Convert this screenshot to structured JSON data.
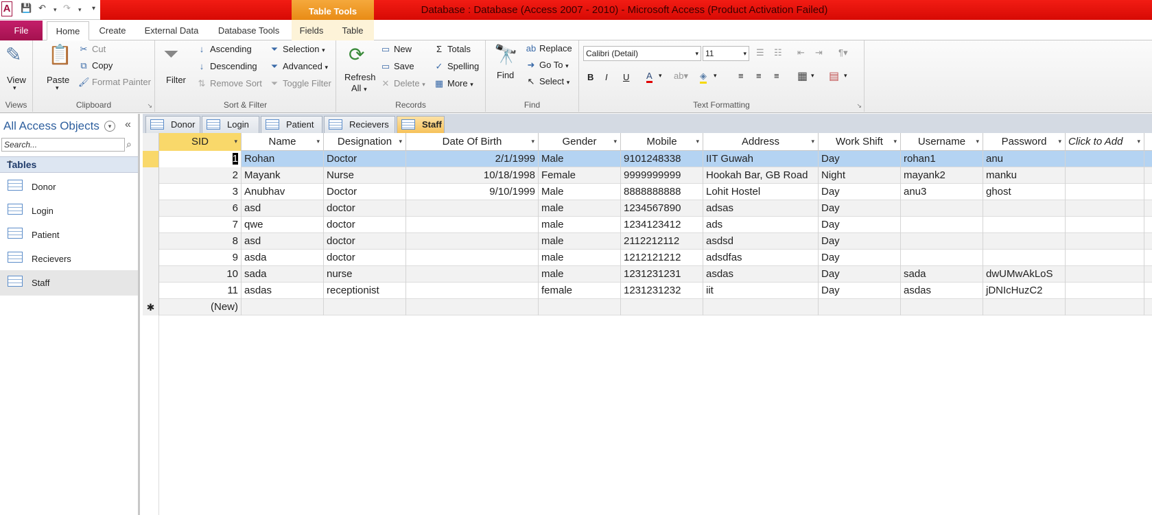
{
  "window": {
    "title": "Database : Database (Access 2007 - 2010) -  Microsoft Access (Product Activation Failed)",
    "context_tab": "Table Tools"
  },
  "ribbon_tabs": {
    "file": "File",
    "home": "Home",
    "create": "Create",
    "external_data": "External Data",
    "database_tools": "Database Tools",
    "fields": "Fields",
    "table": "Table"
  },
  "ribbon": {
    "views": {
      "label": "Views",
      "view": "View"
    },
    "clipboard": {
      "label": "Clipboard",
      "paste": "Paste",
      "cut": "Cut",
      "copy": "Copy",
      "format_painter": "Format Painter"
    },
    "sort_filter": {
      "label": "Sort & Filter",
      "filter": "Filter",
      "ascending": "Ascending",
      "descending": "Descending",
      "remove_sort": "Remove Sort",
      "selection": "Selection",
      "advanced": "Advanced",
      "toggle_filter": "Toggle Filter"
    },
    "records": {
      "label": "Records",
      "refresh": "Refresh",
      "refresh_all": "All",
      "new": "New",
      "save": "Save",
      "delete": "Delete",
      "totals": "Totals",
      "spelling": "Spelling",
      "more": "More"
    },
    "find": {
      "label": "Find",
      "find": "Find",
      "replace": "Replace",
      "goto": "Go To",
      "select": "Select"
    },
    "text_formatting": {
      "label": "Text Formatting",
      "font": "Calibri (Detail)",
      "size": "11"
    }
  },
  "nav": {
    "title": "All Access Objects",
    "search_placeholder": "Search...",
    "section": "Tables",
    "items": [
      {
        "label": "Donor"
      },
      {
        "label": "Login"
      },
      {
        "label": "Patient"
      },
      {
        "label": "Recievers"
      },
      {
        "label": "Staff"
      }
    ]
  },
  "doc_tabs": [
    "Donor",
    "Login",
    "Patient",
    "Recievers",
    "Staff"
  ],
  "grid": {
    "columns": [
      "SID",
      "Name",
      "Designation",
      "Date Of Birth",
      "Gender",
      "Mobile",
      "Address",
      "Work Shift",
      "Username",
      "Password",
      "Click to Add"
    ],
    "rows": [
      [
        "1",
        "Rohan",
        "Doctor",
        "2/1/1999",
        "Male",
        "9101248338",
        "IIT Guwah",
        "Day",
        "rohan1",
        "anu"
      ],
      [
        "2",
        "Mayank",
        "Nurse",
        "10/18/1998",
        "Female",
        "9999999999",
        "Hookah Bar, GB Road",
        "Night",
        "mayank2",
        "manku"
      ],
      [
        "3",
        "Anubhav",
        "Doctor",
        "9/10/1999",
        "Male",
        "8888888888",
        "Lohit Hostel",
        "Day",
        "anu3",
        "ghost"
      ],
      [
        "6",
        "asd",
        "doctor",
        "",
        "male",
        "1234567890",
        "adsas",
        "Day",
        "",
        ""
      ],
      [
        "7",
        "qwe",
        "doctor",
        "",
        "male",
        "1234123412",
        "ads",
        "Day",
        "",
        ""
      ],
      [
        "8",
        "asd",
        "doctor",
        "",
        "male",
        "2112212112",
        "asdsd",
        "Day",
        "",
        ""
      ],
      [
        "9",
        "asda",
        "doctor",
        "",
        "male",
        "1212121212",
        "adsdfas",
        "Day",
        "",
        ""
      ],
      [
        "10",
        "sada",
        "nurse",
        "",
        "male",
        "1231231231",
        "asdas",
        "Day",
        "sada",
        "dwUMwAkLoS"
      ],
      [
        "11",
        "asdas",
        "receptionist",
        "",
        "female",
        "1231231232",
        "iit",
        "Day",
        "asdas",
        "jDNIcHuzC2"
      ]
    ],
    "new_row_label": "(New)",
    "new_row_marker": "✱"
  },
  "colors": {
    "title_bar": "#e0140c",
    "file_tab": "#b3185c",
    "table_tools": "#f0a030",
    "selected_row": "#b4d3f2",
    "header_selected": "#f9d86a"
  }
}
